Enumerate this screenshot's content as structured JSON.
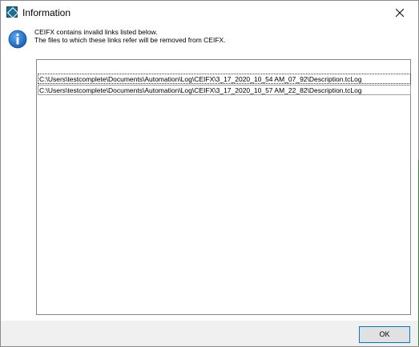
{
  "window": {
    "title": "Information"
  },
  "message": {
    "line1": "CEIFX contains invalid links listed below.",
    "line2": "The files to which these links refer will be removed from CEIFX."
  },
  "links": [
    "C:\\Users\\testcomplete\\Documents\\Automation\\Log\\CEIFX\\3_17_2020_10_54 AM_07_92\\Description.tcLog",
    "C:\\Users\\testcomplete\\Documents\\Automation\\Log\\CEIFX\\3_17_2020_10_57 AM_22_82\\Description.tcLog"
  ],
  "buttons": {
    "ok": "OK"
  },
  "icons": {
    "app": "app-icon",
    "info": "info-icon",
    "close": "close-icon"
  },
  "colors": {
    "info_blue": "#1a6fd0",
    "accent": "#0078d7",
    "footer": "#f0f0f0"
  }
}
